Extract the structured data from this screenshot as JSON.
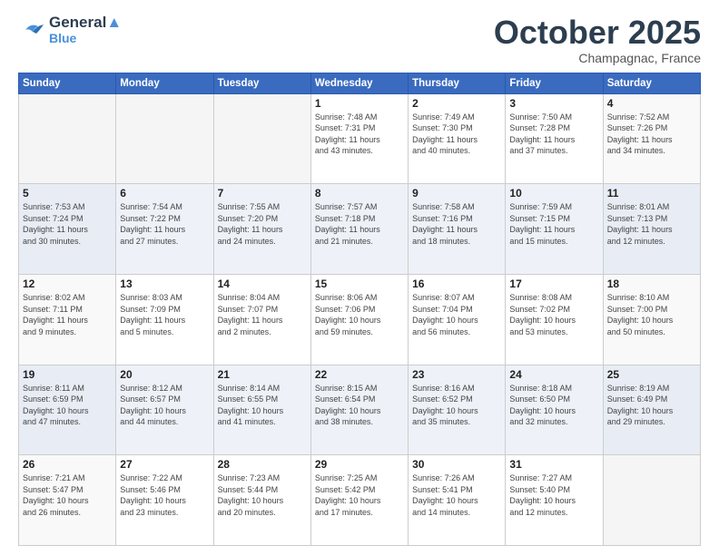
{
  "header": {
    "logo_line1": "General",
    "logo_line2": "Blue",
    "month": "October 2025",
    "location": "Champagnac, France"
  },
  "weekdays": [
    "Sunday",
    "Monday",
    "Tuesday",
    "Wednesday",
    "Thursday",
    "Friday",
    "Saturday"
  ],
  "weeks": [
    [
      {
        "day": "",
        "info": ""
      },
      {
        "day": "",
        "info": ""
      },
      {
        "day": "",
        "info": ""
      },
      {
        "day": "1",
        "info": "Sunrise: 7:48 AM\nSunset: 7:31 PM\nDaylight: 11 hours\nand 43 minutes."
      },
      {
        "day": "2",
        "info": "Sunrise: 7:49 AM\nSunset: 7:30 PM\nDaylight: 11 hours\nand 40 minutes."
      },
      {
        "day": "3",
        "info": "Sunrise: 7:50 AM\nSunset: 7:28 PM\nDaylight: 11 hours\nand 37 minutes."
      },
      {
        "day": "4",
        "info": "Sunrise: 7:52 AM\nSunset: 7:26 PM\nDaylight: 11 hours\nand 34 minutes."
      }
    ],
    [
      {
        "day": "5",
        "info": "Sunrise: 7:53 AM\nSunset: 7:24 PM\nDaylight: 11 hours\nand 30 minutes."
      },
      {
        "day": "6",
        "info": "Sunrise: 7:54 AM\nSunset: 7:22 PM\nDaylight: 11 hours\nand 27 minutes."
      },
      {
        "day": "7",
        "info": "Sunrise: 7:55 AM\nSunset: 7:20 PM\nDaylight: 11 hours\nand 24 minutes."
      },
      {
        "day": "8",
        "info": "Sunrise: 7:57 AM\nSunset: 7:18 PM\nDaylight: 11 hours\nand 21 minutes."
      },
      {
        "day": "9",
        "info": "Sunrise: 7:58 AM\nSunset: 7:16 PM\nDaylight: 11 hours\nand 18 minutes."
      },
      {
        "day": "10",
        "info": "Sunrise: 7:59 AM\nSunset: 7:15 PM\nDaylight: 11 hours\nand 15 minutes."
      },
      {
        "day": "11",
        "info": "Sunrise: 8:01 AM\nSunset: 7:13 PM\nDaylight: 11 hours\nand 12 minutes."
      }
    ],
    [
      {
        "day": "12",
        "info": "Sunrise: 8:02 AM\nSunset: 7:11 PM\nDaylight: 11 hours\nand 9 minutes."
      },
      {
        "day": "13",
        "info": "Sunrise: 8:03 AM\nSunset: 7:09 PM\nDaylight: 11 hours\nand 5 minutes."
      },
      {
        "day": "14",
        "info": "Sunrise: 8:04 AM\nSunset: 7:07 PM\nDaylight: 11 hours\nand 2 minutes."
      },
      {
        "day": "15",
        "info": "Sunrise: 8:06 AM\nSunset: 7:06 PM\nDaylight: 10 hours\nand 59 minutes."
      },
      {
        "day": "16",
        "info": "Sunrise: 8:07 AM\nSunset: 7:04 PM\nDaylight: 10 hours\nand 56 minutes."
      },
      {
        "day": "17",
        "info": "Sunrise: 8:08 AM\nSunset: 7:02 PM\nDaylight: 10 hours\nand 53 minutes."
      },
      {
        "day": "18",
        "info": "Sunrise: 8:10 AM\nSunset: 7:00 PM\nDaylight: 10 hours\nand 50 minutes."
      }
    ],
    [
      {
        "day": "19",
        "info": "Sunrise: 8:11 AM\nSunset: 6:59 PM\nDaylight: 10 hours\nand 47 minutes."
      },
      {
        "day": "20",
        "info": "Sunrise: 8:12 AM\nSunset: 6:57 PM\nDaylight: 10 hours\nand 44 minutes."
      },
      {
        "day": "21",
        "info": "Sunrise: 8:14 AM\nSunset: 6:55 PM\nDaylight: 10 hours\nand 41 minutes."
      },
      {
        "day": "22",
        "info": "Sunrise: 8:15 AM\nSunset: 6:54 PM\nDaylight: 10 hours\nand 38 minutes."
      },
      {
        "day": "23",
        "info": "Sunrise: 8:16 AM\nSunset: 6:52 PM\nDaylight: 10 hours\nand 35 minutes."
      },
      {
        "day": "24",
        "info": "Sunrise: 8:18 AM\nSunset: 6:50 PM\nDaylight: 10 hours\nand 32 minutes."
      },
      {
        "day": "25",
        "info": "Sunrise: 8:19 AM\nSunset: 6:49 PM\nDaylight: 10 hours\nand 29 minutes."
      }
    ],
    [
      {
        "day": "26",
        "info": "Sunrise: 7:21 AM\nSunset: 5:47 PM\nDaylight: 10 hours\nand 26 minutes."
      },
      {
        "day": "27",
        "info": "Sunrise: 7:22 AM\nSunset: 5:46 PM\nDaylight: 10 hours\nand 23 minutes."
      },
      {
        "day": "28",
        "info": "Sunrise: 7:23 AM\nSunset: 5:44 PM\nDaylight: 10 hours\nand 20 minutes."
      },
      {
        "day": "29",
        "info": "Sunrise: 7:25 AM\nSunset: 5:42 PM\nDaylight: 10 hours\nand 17 minutes."
      },
      {
        "day": "30",
        "info": "Sunrise: 7:26 AM\nSunset: 5:41 PM\nDaylight: 10 hours\nand 14 minutes."
      },
      {
        "day": "31",
        "info": "Sunrise: 7:27 AM\nSunset: 5:40 PM\nDaylight: 10 hours\nand 12 minutes."
      },
      {
        "day": "",
        "info": ""
      }
    ]
  ]
}
